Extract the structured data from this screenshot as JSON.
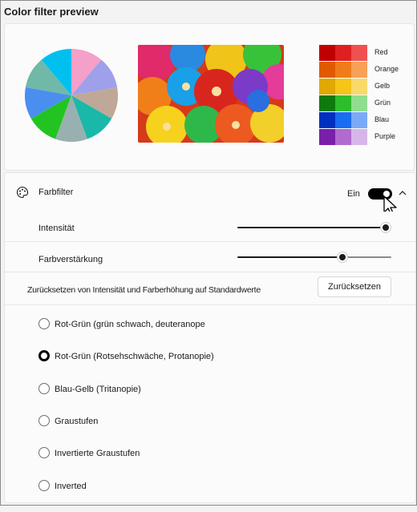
{
  "title": "Color filter preview",
  "swatches": [
    {
      "label": "Red",
      "colors": [
        "#c00000",
        "#e02020",
        "#f05050"
      ]
    },
    {
      "label": "Orange",
      "colors": [
        "#e05a00",
        "#f07b1a",
        "#f6a058"
      ]
    },
    {
      "label": "Gelb",
      "colors": [
        "#e0a800",
        "#f5c518",
        "#f8d96a"
      ]
    },
    {
      "label": "Grün",
      "colors": [
        "#0e7a0e",
        "#2dbd2d",
        "#8fde8f"
      ]
    },
    {
      "label": "Blau",
      "colors": [
        "#0030c0",
        "#1a6cf0",
        "#7aaaf7"
      ]
    },
    {
      "label": "Purple",
      "colors": [
        "#7a1fa8",
        "#b06ad0",
        "#d6b6ea"
      ]
    }
  ],
  "pie_colors": [
    "#f4a0c8",
    "#9ea0ea",
    "#c0a898",
    "#1ab8a8",
    "#98b0b0",
    "#22c422",
    "#4a8ef0",
    "#70b8a8",
    "#00c0f0"
  ],
  "filter": {
    "label": "Farbfilter",
    "state_label": "Ein",
    "enabled": true,
    "palette_icon": "palette-icon",
    "chevron_icon": "chevron-up-icon"
  },
  "intensity": {
    "label": "Intensität",
    "value_fraction": 1.0
  },
  "boost": {
    "label": "Farbverstärkung",
    "value_fraction": 0.68
  },
  "reset": {
    "label": "Zurücksetzen von Intensität und Farberhöhung auf Standardwerte",
    "button": "Zurücksetzen"
  },
  "options": [
    {
      "label": "Rot-Grün (grün schwach, deuteranope",
      "selected": false
    },
    {
      "label": "Rot-Grün (Rotsehschwäche, Protanopie)",
      "selected": true
    },
    {
      "label": "Blau-Gelb (Tritanopie)",
      "selected": false
    },
    {
      "label": "Graustufen",
      "selected": false
    },
    {
      "label": "Invertierte Graustufen",
      "selected": false
    },
    {
      "label": "Inverted",
      "selected": false
    }
  ]
}
